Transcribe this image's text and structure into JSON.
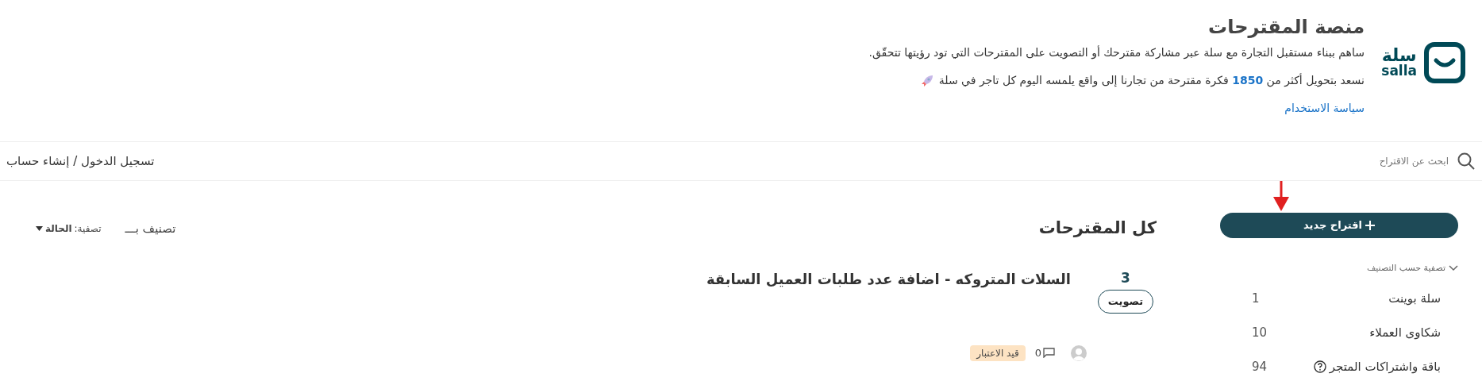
{
  "header": {
    "logo": {
      "arabic": "سلة",
      "latin": "salla"
    },
    "title": "منصة المقترحات",
    "description": "ساهم ببناء مستقبل التجارة مع سلة عبر مشاركة مقترحك أو التصويت على المقترحات التي تود رؤيتها تتحقّق.",
    "stats": {
      "before": "نسعد بتحويل أكثر من",
      "count": "1850",
      "after": "فكرة مقترحة من تجارنا إلى واقع يلمسه اليوم كل تاجر في سلة"
    },
    "policy_link": "سياسة الاستخدام"
  },
  "search": {
    "placeholder": "ابحث عن الاقتراح"
  },
  "auth_link": "تسجيل الدخول / إنشاء حساب",
  "new_button": "اقتراح جديد",
  "sidebar": {
    "filter_heading": "تصفية حسب التصنيف",
    "expanded": true,
    "categories": [
      {
        "name": "سلة بوينت",
        "count": "1",
        "help": false
      },
      {
        "name": "شكاوى العملاء",
        "count": "10",
        "help": false
      },
      {
        "name": "باقة واشتراكات المتجر",
        "count": "94",
        "help": true
      }
    ]
  },
  "main": {
    "title": "كل المقترحات",
    "sort_label": "تصنيف بـــ",
    "filter": {
      "label": "تصفية:",
      "value": "الحالة"
    }
  },
  "posts": [
    {
      "votes": "3",
      "vote_button": "تصويت",
      "title": "السلات المتروكه - اضافة عدد طلبات العميل السابقة",
      "comments": "0",
      "status": "قيد الاعتبار"
    }
  ]
}
